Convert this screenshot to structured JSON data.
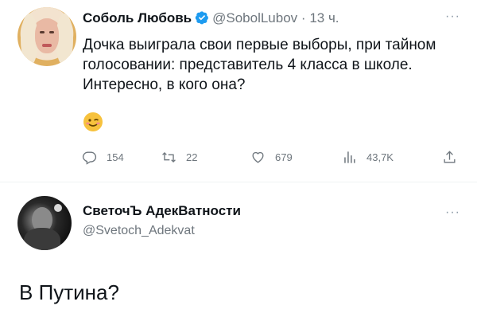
{
  "tweet": {
    "author_name": "Соболь Любовь",
    "author_handle": "@SobolLubov",
    "separator": "·",
    "time": "13 ч.",
    "more": "···",
    "text": "Дочка выиграла свои первые выборы, при тайном голосовании: представитель 4 класса в школе. Интересно, в кого она?",
    "emoji": "winking-face",
    "actions": {
      "replies": "154",
      "retweets": "22",
      "likes": "679",
      "views": "43,7K"
    }
  },
  "reply_account": {
    "name": "СветочЪ АдекВатности",
    "handle": "@Svetoch_Adekvat",
    "more": "···"
  },
  "reply": {
    "text": "В Путина?"
  },
  "colors": {
    "text": "#0f1419",
    "muted": "#6e767d",
    "verified": "#1d9bf0",
    "emoji": "#f7c23d"
  }
}
